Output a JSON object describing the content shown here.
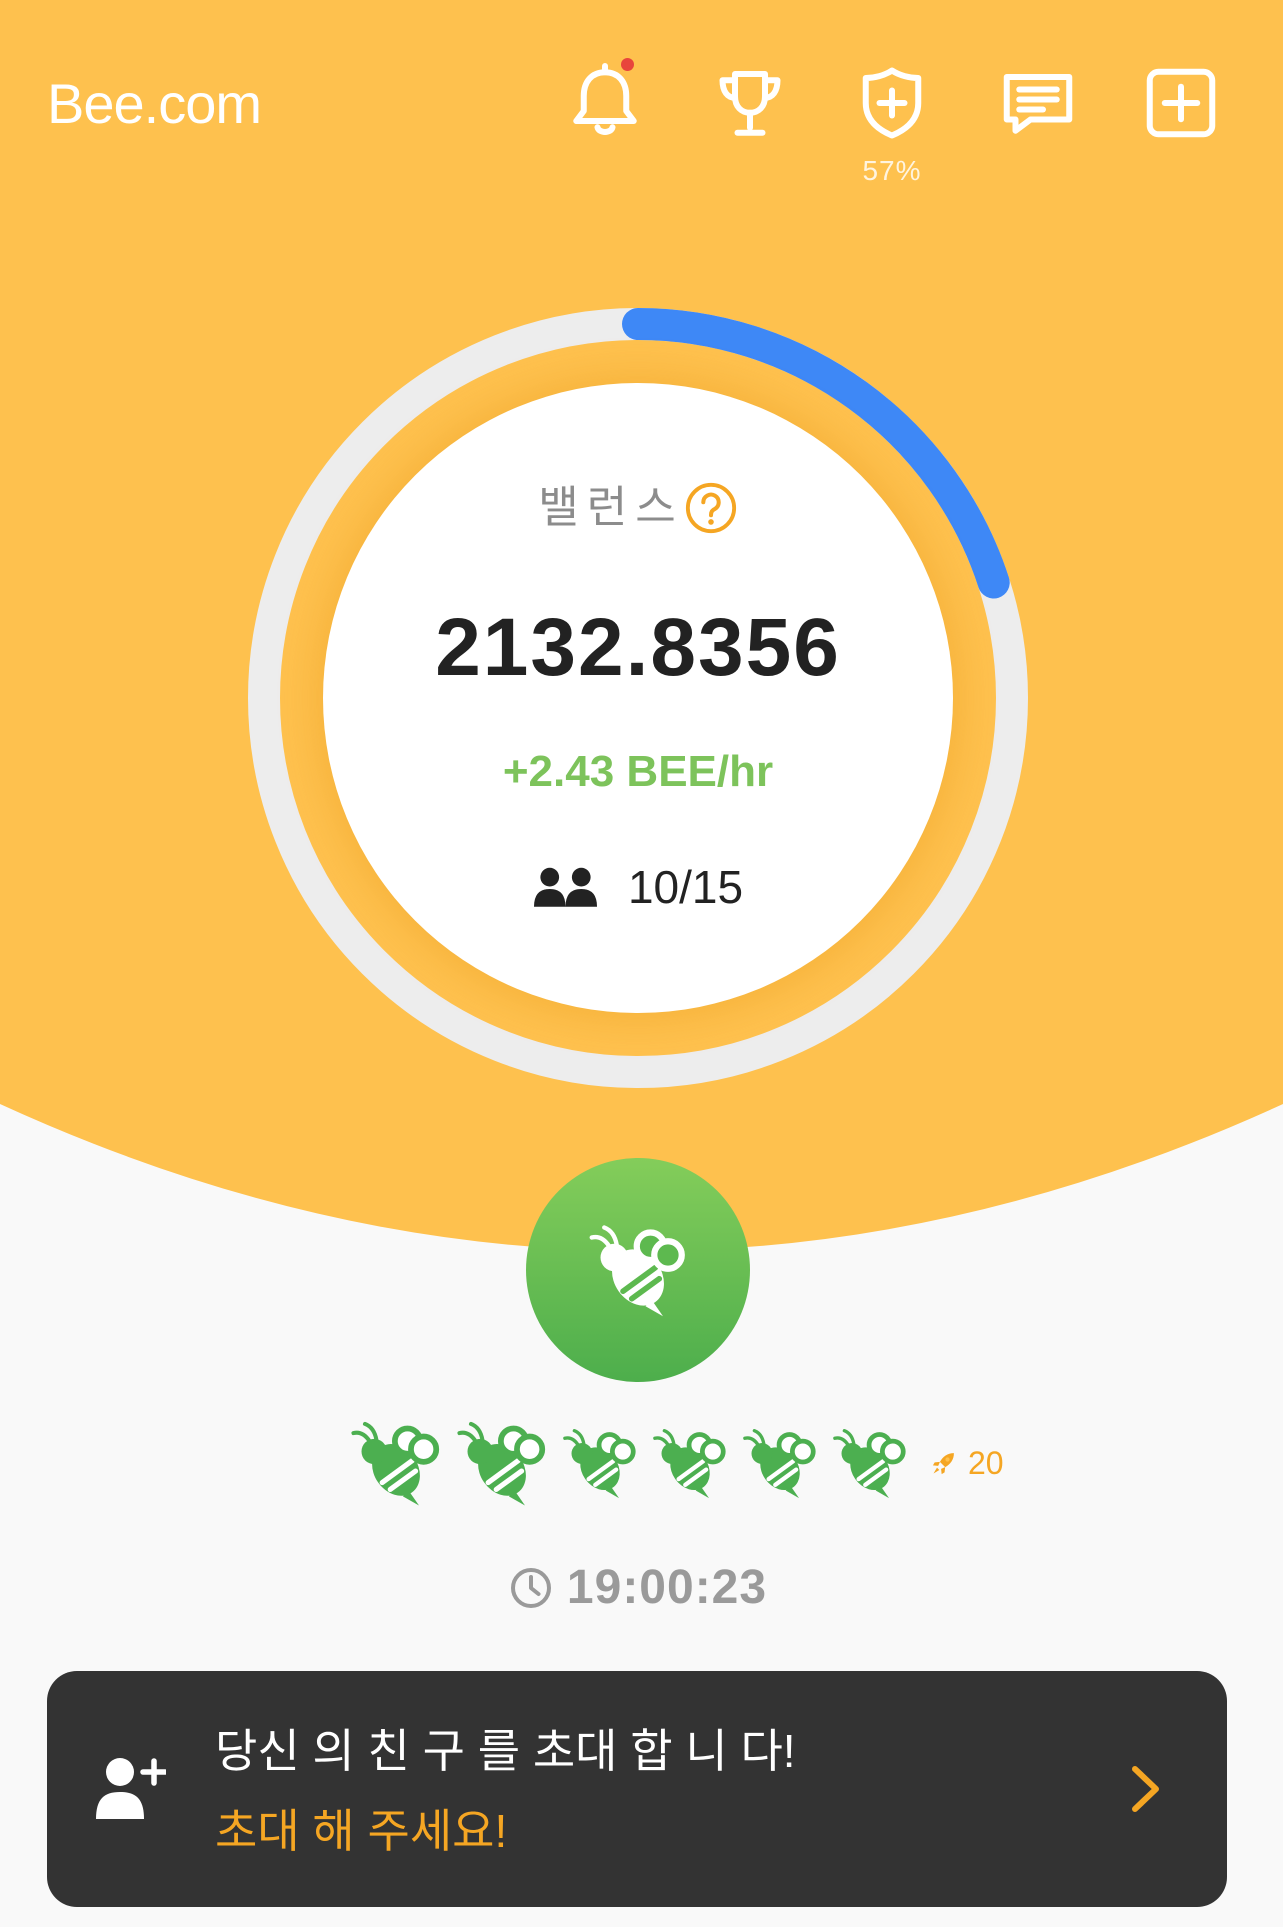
{
  "header": {
    "logo": "Bee.com",
    "notifications": {
      "icon": "bell-icon",
      "has_unread": true
    },
    "trophy": {
      "icon": "trophy-icon"
    },
    "shield": {
      "icon": "shield-plus-icon",
      "percent": "57%"
    },
    "chat": {
      "icon": "chat-icon"
    },
    "add": {
      "icon": "plus-square-icon"
    }
  },
  "balance": {
    "label": "밸런스",
    "help_icon": "question-circle-icon",
    "value": "2132.8356",
    "rate": "+2.43 BEE/hr",
    "team_icon": "people-icon",
    "team_count": "10/15",
    "progress": 0.2
  },
  "mine_button": {
    "icon": "bee-icon"
  },
  "team_bees": {
    "icons": [
      "bee-icon",
      "bee-icon",
      "bee-icon",
      "bee-icon",
      "bee-icon",
      "bee-icon"
    ],
    "boost_icon": "rocket-icon",
    "boost_value": "20"
  },
  "timer": {
    "icon": "clock-icon",
    "value": "19:00:23"
  },
  "invite": {
    "icon": "person-add-icon",
    "title": "당신 의 친 구 를 초대 합 니 다!",
    "subtitle": "초대 해 주세요!",
    "action_icon": "chevron-right-icon"
  },
  "colors": {
    "header_background": "#FEC14E",
    "progress": "#3E88F6",
    "rate": "#7DC35B",
    "banner": "#333333",
    "highlight": "#F5A623",
    "notification_dot": "#E8453C"
  }
}
